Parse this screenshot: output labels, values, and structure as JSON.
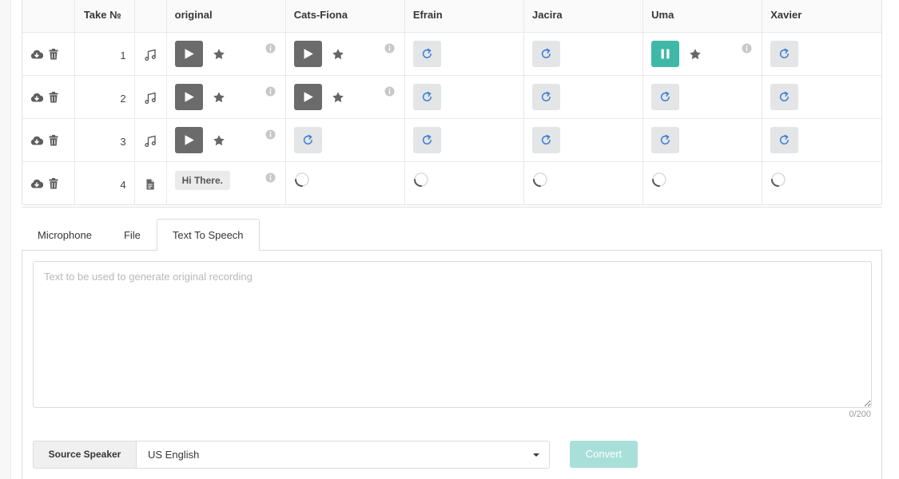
{
  "table": {
    "headers": {
      "take": "Take №",
      "original": "original",
      "speakers": [
        "Cats-Fiona",
        "Efrain",
        "Jacira",
        "Uma",
        "Xavier"
      ]
    },
    "rows": [
      {
        "take": "1",
        "kind": "music-note-icon",
        "original": "play",
        "cells": [
          "play",
          "retry",
          "retry",
          "pause",
          "retry"
        ]
      },
      {
        "take": "2",
        "kind": "music-note-icon",
        "original": "play",
        "cells": [
          "play",
          "retry",
          "retry",
          "retry",
          "retry"
        ]
      },
      {
        "take": "3",
        "kind": "music-note-icon",
        "original": "play",
        "cells": [
          "retry",
          "retry",
          "retry",
          "retry",
          "retry"
        ]
      },
      {
        "take": "4",
        "kind": "document-icon",
        "original": "text",
        "original_text": "Hi There.",
        "cells": [
          "loading",
          "loading",
          "loading",
          "loading",
          "loading"
        ]
      }
    ]
  },
  "tabs": [
    "Microphone",
    "File",
    "Text To Speech"
  ],
  "active_tab": "Text To Speech",
  "tts": {
    "placeholder": "Text to be used to generate original recording",
    "counter": "0/200",
    "source_label": "Source Speaker",
    "source_value": "US English",
    "convert_label": "Convert"
  },
  "colors": {
    "play": "#6b6b6b",
    "pause": "#3fb8a8",
    "retry_bg": "#e4e5e6",
    "retry_icon": "#3e7fd6",
    "convert_disabled": "#a8e0d9"
  }
}
